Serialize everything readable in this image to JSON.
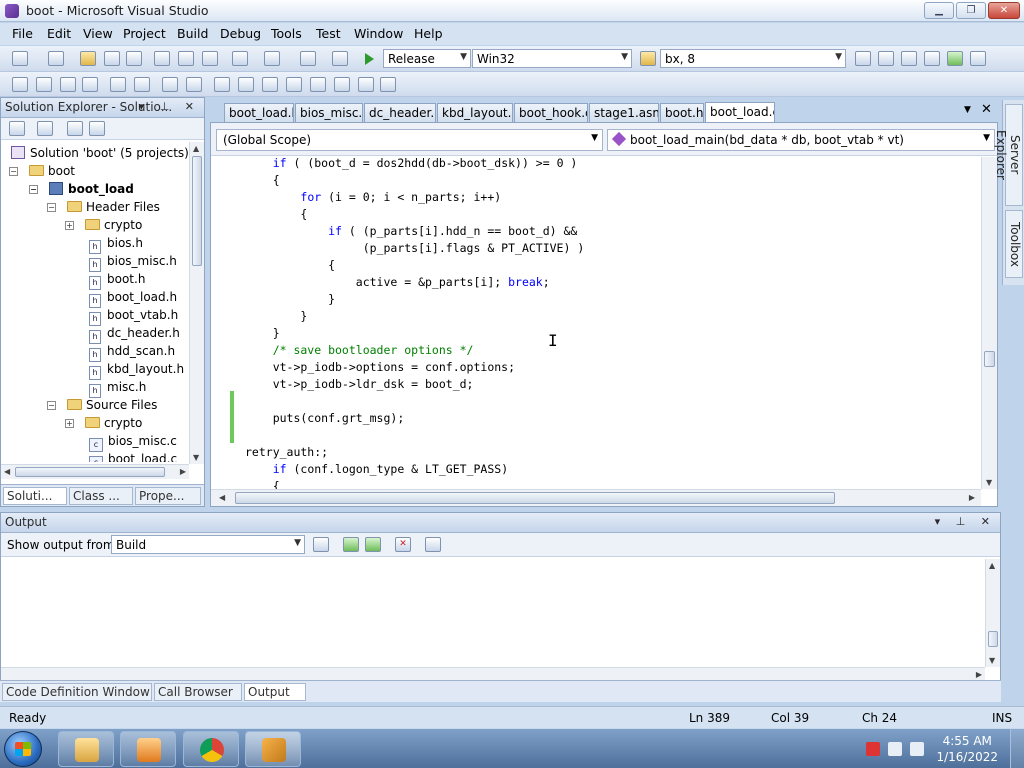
{
  "window": {
    "title": "boot - Microsoft Visual Studio",
    "minimize": "▁",
    "maximize": "❐",
    "close": "✕"
  },
  "menu": [
    "File",
    "Edit",
    "View",
    "Project",
    "Build",
    "Debug",
    "Tools",
    "Test",
    "Window",
    "Help"
  ],
  "toolbar": {
    "configuration": "Release",
    "platform": "Win32",
    "find_box": "bx, 8"
  },
  "solution_explorer": {
    "title": "Solution Explorer - Solutio...",
    "header_buttons": "▾ ⊥ ✕",
    "items": [
      {
        "label": "Solution 'boot' (5 projects)",
        "icon": "solution-icon"
      },
      {
        "label": "boot",
        "icon": "folder-icon"
      },
      {
        "label": "boot_load",
        "icon": "project-icon"
      },
      {
        "label": "Header Files",
        "icon": "folder-icon"
      },
      {
        "label": "crypto",
        "icon": "folder-icon"
      },
      {
        "label": "bios.h",
        "icon": "header-file-icon"
      },
      {
        "label": "bios_misc.h",
        "icon": "header-file-icon"
      },
      {
        "label": "boot.h",
        "icon": "header-file-icon"
      },
      {
        "label": "boot_load.h",
        "icon": "header-file-icon"
      },
      {
        "label": "boot_vtab.h",
        "icon": "header-file-icon"
      },
      {
        "label": "dc_header.h",
        "icon": "header-file-icon"
      },
      {
        "label": "hdd_scan.h",
        "icon": "header-file-icon"
      },
      {
        "label": "kbd_layout.h",
        "icon": "header-file-icon"
      },
      {
        "label": "misc.h",
        "icon": "header-file-icon"
      },
      {
        "label": "Source Files",
        "icon": "folder-icon"
      },
      {
        "label": "crypto",
        "icon": "folder-icon"
      },
      {
        "label": "bios_misc.c",
        "icon": "c-file-icon"
      },
      {
        "label": "boot_load.c",
        "icon": "c-file-icon"
      }
    ],
    "bottom_tabs": [
      "Soluti...",
      "Class ...",
      "Prope..."
    ]
  },
  "editor": {
    "tabs": [
      "boot_load.h",
      "bios_misc.c",
      "dc_header.c",
      "kbd_layout.c",
      "boot_hook.c",
      "stage1.asm",
      "boot.h",
      "boot_load.c"
    ],
    "active_tab": "boot_load.c",
    "scope": "(Global Scope)",
    "function": "boot_load_main(bd_data * db, boot_vtab * vt)",
    "code": [
      "    if ( (boot_d = dos2hdd(db->boot_dsk)) >= 0 )",
      "    {",
      "        for (i = 0; i < n_parts; i++)",
      "        {",
      "            if ( (p_parts[i].hdd_n == boot_d) &&",
      "                 (p_parts[i].flags & PT_ACTIVE) )",
      "            {",
      "                active = &p_parts[i]; break;",
      "            }",
      "        }",
      "    }",
      "    /* save bootloader options */",
      "    vt->p_iodb->options = conf.options;",
      "    vt->p_iodb->ldr_dsk = boot_d;",
      "",
      "    puts(conf.grt_msg);",
      "",
      "retry_auth:;",
      "    if (conf.logon_type & LT_GET_PASS)",
      "    {"
    ]
  },
  "side_tabs": [
    "Server Explorer",
    "Toolbox"
  ],
  "output": {
    "title": "Output",
    "show_from_label": "Show output from:",
    "source": "Build",
    "bottom_tabs": [
      "Code Definition Window",
      "Call Browser",
      "Output"
    ]
  },
  "status": {
    "message": "Ready",
    "line": "Ln 389",
    "col": "Col 39",
    "ch": "Ch 24",
    "mode": "INS"
  },
  "taskbar": {
    "time": "4:55 AM",
    "date": "1/16/2022"
  }
}
